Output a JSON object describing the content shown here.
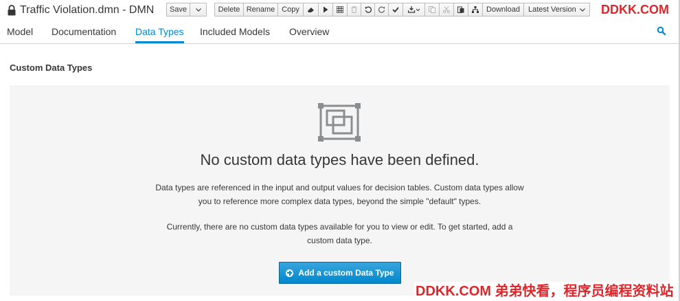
{
  "app": {
    "title": "Traffic Violation.dmn - DMN"
  },
  "toolbar": {
    "save_label": "Save",
    "delete_label": "Delete",
    "rename_label": "Rename",
    "copy_label": "Copy",
    "download_label": "Download",
    "latest_version_label": "Latest Version"
  },
  "tabs": [
    {
      "label": "Model"
    },
    {
      "label": "Documentation"
    },
    {
      "label": "Data Types"
    },
    {
      "label": "Included Models"
    },
    {
      "label": "Overview"
    }
  ],
  "active_tab": "Data Types",
  "main": {
    "section_title": "Custom Data Types",
    "empty_title": "No custom data types have been defined.",
    "empty_desc_1": "Data types are referenced in the input and output values for decision tables. Custom data types allow you to reference more complex data types, beyond the simple \"default\" types.",
    "empty_desc_2": "Currently, there are no custom data types available for you to view or edit. To get started, add a custom data type.",
    "add_button_label": "Add a custom Data Type"
  },
  "watermarks": {
    "top": "DDKK.COM",
    "bottom": "DDKK.COM 弟弟快看，程序员编程资料站"
  },
  "colors": {
    "accent": "#0088ce",
    "button_primary": "#39a5dc",
    "panel_bg": "#f5f5f5",
    "watermark": "#e0252a"
  },
  "icons": [
    "lock-icon",
    "caret-down-icon",
    "eraser-icon",
    "play-icon",
    "grid-icon",
    "trash-icon",
    "undo-icon",
    "redo-icon",
    "check-icon",
    "download-icon",
    "copy-icon",
    "cut-icon",
    "paste-icon",
    "hierarchy-icon",
    "search-icon",
    "data-types-icon",
    "plus-circle-icon"
  ]
}
